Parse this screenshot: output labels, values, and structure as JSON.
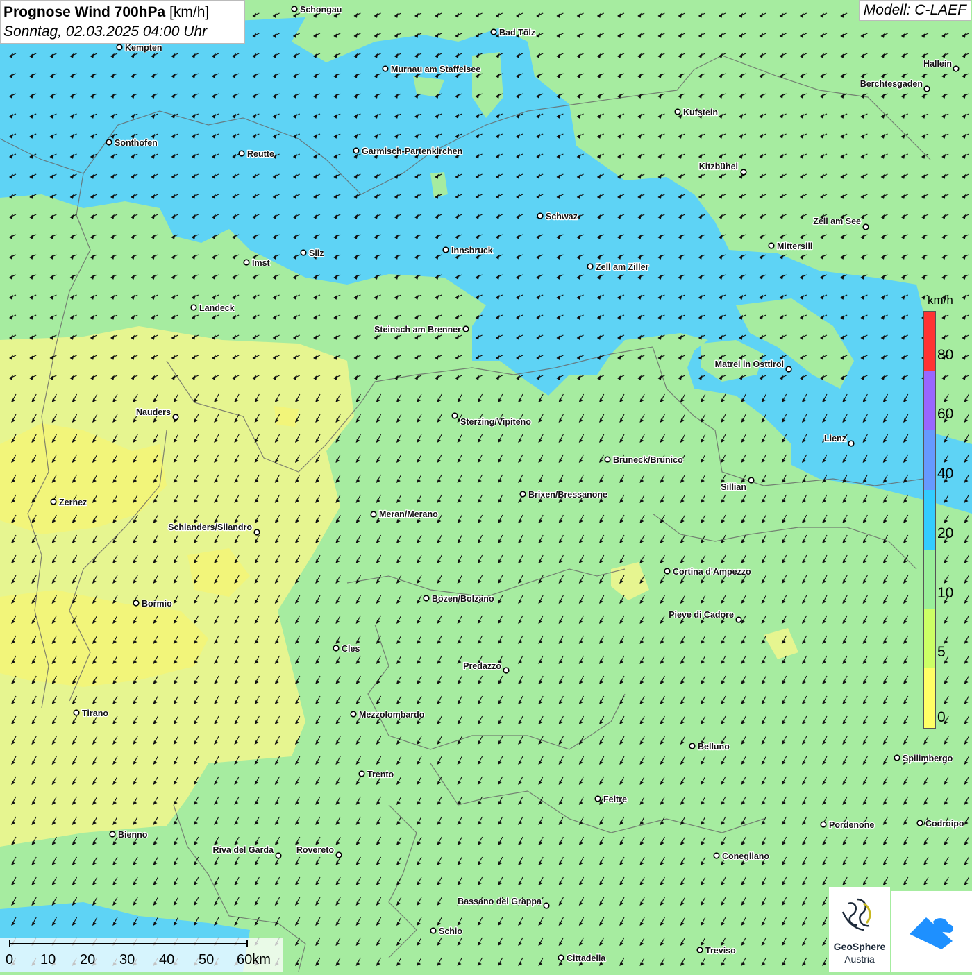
{
  "header": {
    "title_bold": "Prognose Wind 700hPa",
    "title_unit": "[km/h]",
    "subtitle": "Sonntag, 02.03.2025 04:00 Uhr"
  },
  "model": {
    "label": "Modell: C-LAEF"
  },
  "legend": {
    "unit": "km/h",
    "stops": [
      {
        "value": "0",
        "color": "#ffff66"
      },
      {
        "value": "5",
        "color": "#ccff66"
      },
      {
        "value": "10",
        "color": "#99ee99"
      },
      {
        "value": "20",
        "color": "#33ccff"
      },
      {
        "value": "40",
        "color": "#6699ff"
      },
      {
        "value": "60",
        "color": "#9966ff"
      },
      {
        "value": "80",
        "color": "#ff3333"
      }
    ]
  },
  "wind": {
    "direction": "from northeast (arrows pointing south-west)"
  },
  "cities": [
    {
      "name": "Schongau"
    },
    {
      "name": "Bad Tölz"
    },
    {
      "name": "Kempten"
    },
    {
      "name": "Murnau am Staffelsee"
    },
    {
      "name": "Hallein"
    },
    {
      "name": "Berchtesgaden"
    },
    {
      "name": "Kufstein"
    },
    {
      "name": "Sonthofen"
    },
    {
      "name": "Reutte"
    },
    {
      "name": "Garmisch-Partenkirchen"
    },
    {
      "name": "Kitzbühel"
    },
    {
      "name": "Schwaz"
    },
    {
      "name": "Zell am See"
    },
    {
      "name": "Mittersill"
    },
    {
      "name": "Innsbruck"
    },
    {
      "name": "Silz"
    },
    {
      "name": "Imst"
    },
    {
      "name": "Zell am Ziller"
    },
    {
      "name": "Landeck"
    },
    {
      "name": "Steinach am Brenner"
    },
    {
      "name": "Matrei in Osttirol"
    },
    {
      "name": "Nauders"
    },
    {
      "name": "Sterzing/Vipiteno"
    },
    {
      "name": "Lienz"
    },
    {
      "name": "Bruneck/Brunico"
    },
    {
      "name": "Sillian"
    },
    {
      "name": "Zernez"
    },
    {
      "name": "Brixen/Bressanone"
    },
    {
      "name": "Meran/Merano"
    },
    {
      "name": "Schlanders/Silandro"
    },
    {
      "name": "Cortina d'Ampezzo"
    },
    {
      "name": "Bormio"
    },
    {
      "name": "Bozen/Bolzano"
    },
    {
      "name": "Pieve di Cadore"
    },
    {
      "name": "Cles"
    },
    {
      "name": "Predazzo"
    },
    {
      "name": "Tirano"
    },
    {
      "name": "Mezzolombardo"
    },
    {
      "name": "Belluno"
    },
    {
      "name": "Spilimbergo"
    },
    {
      "name": "Trento"
    },
    {
      "name": "Feltre"
    },
    {
      "name": "Pordenone"
    },
    {
      "name": "Codroipo"
    },
    {
      "name": "Bienno"
    },
    {
      "name": "Riva del Garda"
    },
    {
      "name": "Rovereto"
    },
    {
      "name": "Conegliano"
    },
    {
      "name": "Bassano del Grappa"
    },
    {
      "name": "Schio"
    },
    {
      "name": "Treviso"
    },
    {
      "name": "Cittadella"
    }
  ],
  "scale": {
    "ticks": [
      "0",
      "10",
      "20",
      "30",
      "40",
      "50",
      "60km"
    ]
  },
  "logos": {
    "geosphere_line1": "GeoSphere",
    "geosphere_line2": "Austria"
  }
}
